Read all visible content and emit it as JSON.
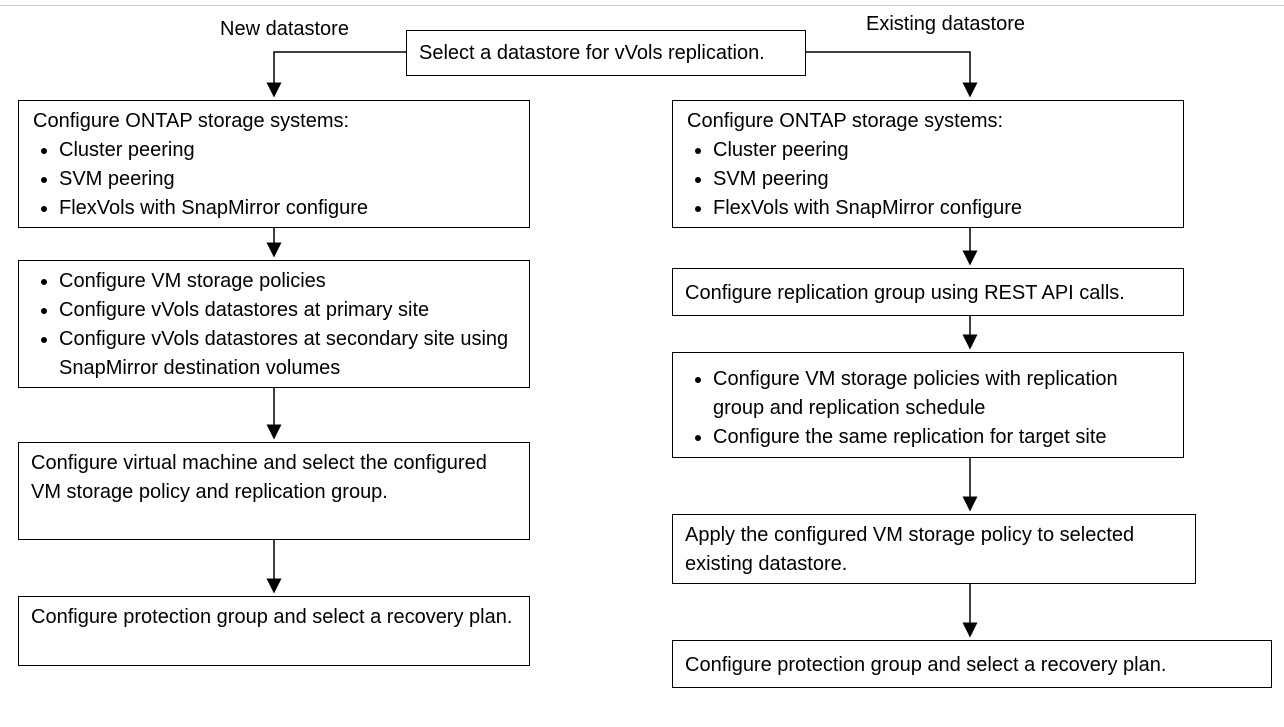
{
  "labels": {
    "new": "New datastore",
    "existing": "Existing  datastore"
  },
  "top_box": "Select a datastore for vVols replication.",
  "left": {
    "b1_lead": "Configure ONTAP storage systems:",
    "b1_items": [
      "Cluster peering",
      "SVM peering",
      "FlexVols with SnapMirror configure"
    ],
    "b2_items": [
      "Configure VM storage policies",
      "Configure vVols datastores at primary site",
      "Configure vVols datastores at secondary site using SnapMirror destination volumes"
    ],
    "b3": "Configure virtual machine and select the configured VM storage policy and replication group.",
    "b4": "Configure protection group and select a recovery plan."
  },
  "right": {
    "b1_lead": "Configure ONTAP storage systems:",
    "b1_items": [
      "Cluster peering",
      "SVM peering",
      "FlexVols with SnapMirror configure"
    ],
    "b2": "Configure replication group using REST API calls.",
    "b3_items": [
      "Configure VM storage policies with replication group and replication schedule",
      "Configure the same replication for target site"
    ],
    "b4": "Apply the configured VM storage policy to selected existing datastore.",
    "b5": "Configure protection group and select a recovery plan."
  }
}
